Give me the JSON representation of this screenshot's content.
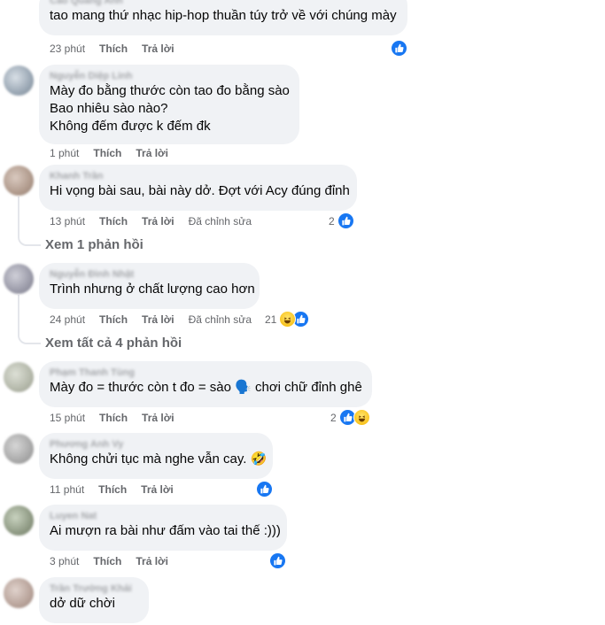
{
  "comments": [
    {
      "author": "Cao Quang Anh",
      "lines": [
        "tao mang thứ nhạc hip-hop thuần túy trở về với chúng mày"
      ],
      "time": "23 phút",
      "like": "Thích",
      "reply": "Trả lời",
      "react_count": ""
    },
    {
      "author": "Nguyễn Diệp Linh",
      "lines": [
        "Mày đo bằng thước còn tao đo bằng sào",
        "Bao nhiêu sào nào?",
        "Không đếm được k đếm đk"
      ],
      "time": "1 phút",
      "like": "Thích",
      "reply": "Trả lời"
    },
    {
      "author": "Khanh Trần",
      "lines": [
        "Hi vọng bài sau, bài này dở. Đợt với Acy đúng đỉnh"
      ],
      "time": "13 phút",
      "like": "Thích",
      "reply": "Trả lời",
      "edited": "Đã chỉnh sửa",
      "react_count": "2",
      "replies_link": "Xem 1 phản hồi"
    },
    {
      "author": "Nguyễn Đình Nhật",
      "lines": [
        "Trình nhưng ở chất lượng cao hơn"
      ],
      "time": "24 phút",
      "like": "Thích",
      "reply": "Trả lời",
      "edited": "Đã chỉnh sửa",
      "react_count": "21",
      "replies_link": "Xem tất cả 4 phản hồi"
    },
    {
      "author": "Phạm Thanh Tùng",
      "lines": [
        "Mày đo = thước còn t đo = sào 🗣️ chơi chữ đỉnh ghê"
      ],
      "time": "15 phút",
      "like": "Thích",
      "reply": "Trả lời",
      "react_count": "2"
    },
    {
      "author": "Phương Anh Vy",
      "lines": [
        "Không chửi tục mà nghe vẫn cay. 🤣"
      ],
      "time": "11 phút",
      "like": "Thích",
      "reply": "Trả lời"
    },
    {
      "author": "Luyen Nat",
      "lines": [
        "Ai mượn ra bài như đấm vào tai thế :)))"
      ],
      "time": "3 phút",
      "like": "Thích",
      "reply": "Trả lời"
    },
    {
      "author": "Trần Trường Khải",
      "lines": [
        "dở dữ chời"
      ]
    }
  ],
  "icons": {
    "like": "thumbs-up-icon",
    "haha": "laughing-face-icon",
    "like_color": "#1877f2",
    "bubble_color": "#f0f2f5"
  }
}
